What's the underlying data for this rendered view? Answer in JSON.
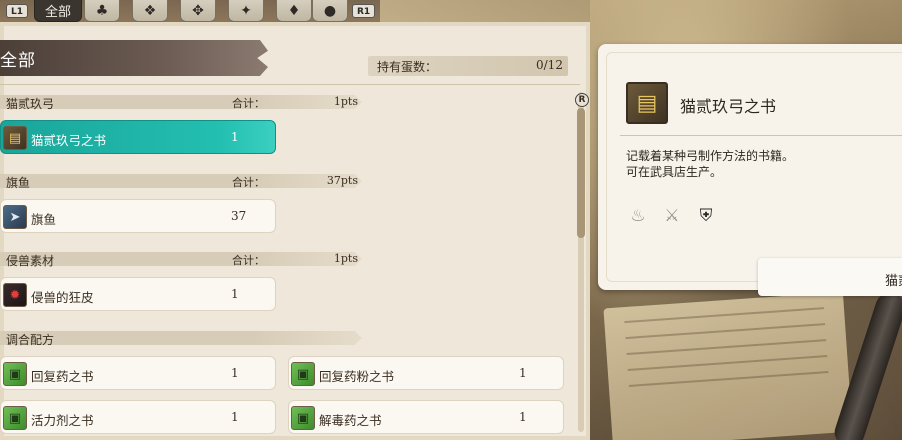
{
  "tabs": {
    "left_hint": "L1",
    "right_hint": "R1",
    "active_label": "全部",
    "icons": [
      "monster-icon",
      "fish-icon",
      "wyvern-icon",
      "bird-icon",
      "pot-icon",
      "egg-icon"
    ]
  },
  "header": {
    "title": "全部",
    "egg_label": "持有蛋数：",
    "egg_count": "0/12"
  },
  "scroll_hint": "R",
  "categories": [
    {
      "name": "猫贰玖弓",
      "total_label": "合计：",
      "total_value": "1pts",
      "items": [
        {
          "name": "猫贰玖弓之书",
          "qty": "1",
          "icon": "book-icon",
          "selected": true
        }
      ]
    },
    {
      "name": "旗鱼",
      "total_label": "合计：",
      "total_value": "37pts",
      "items": [
        {
          "name": "旗鱼",
          "qty": "37",
          "icon": "fish-icon"
        }
      ]
    },
    {
      "name": "侵兽素材",
      "total_label": "合计：",
      "total_value": "1pts",
      "items": [
        {
          "name": "侵兽的狂皮",
          "qty": "1",
          "icon": "hide-icon"
        }
      ]
    },
    {
      "name": "调合配方",
      "items": [
        {
          "name": "回复药之书",
          "qty": "1",
          "icon": "recipe-icon"
        },
        {
          "name": "回复药粉之书",
          "qty": "1",
          "icon": "recipe-icon"
        },
        {
          "name": "活力剂之书",
          "qty": "1",
          "icon": "recipe-icon"
        },
        {
          "name": "解毒药之书",
          "qty": "1",
          "icon": "recipe-icon"
        }
      ]
    }
  ],
  "detail": {
    "title": "猫贰玖弓之书",
    "description_line1": "记载着某种弓制作方法的书籍。",
    "description_line2": "可在武具店生产。",
    "icons": [
      "cooking-pot-icon",
      "fork-knife-icon",
      "armor-icon"
    ],
    "footer_text": "猫贰"
  },
  "colors": {
    "selected": "#1aa59a",
    "panel": "#efe8da",
    "banner": "#4b3f38"
  }
}
